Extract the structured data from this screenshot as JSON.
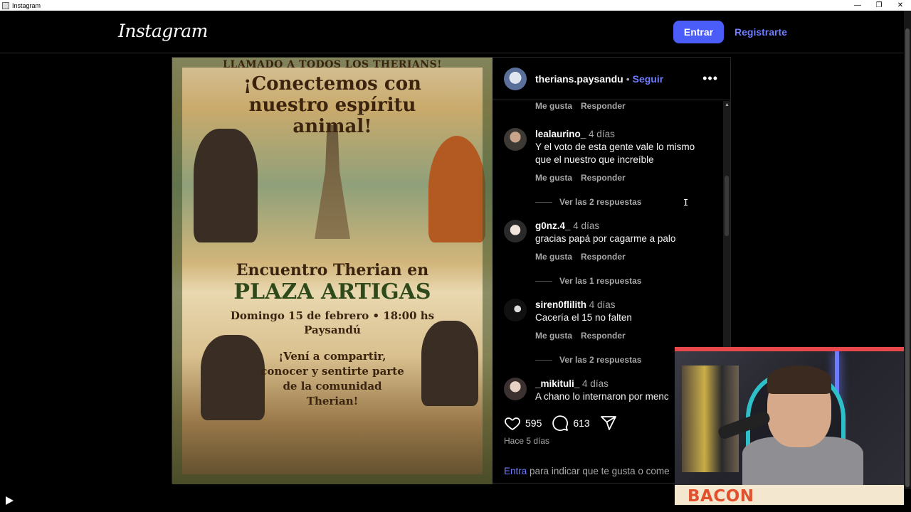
{
  "window": {
    "title": "Instagram",
    "controls": [
      "—",
      "❐",
      "✕"
    ]
  },
  "header": {
    "logo": "Instagram",
    "login_button": "Entrar",
    "signup_link": "Registrarte"
  },
  "poster": {
    "top_line": "LLAMADO A TODOS LOS THERIANS!",
    "headline": "¡Conectemos con nuestro espíritu animal!",
    "encuentro": "Encuentro Therian en",
    "plaza": "PLAZA ARTIGAS",
    "date": "Domingo 15 de febrero • 18:00 hs",
    "city": "Paysandú",
    "invite": "¡Vení a compartir, conocer y sentirte parte de la comunidad Therian!"
  },
  "post": {
    "owner": "therians.paysandu",
    "separator": "•",
    "follow": "Seguir",
    "more": "•••"
  },
  "comments": {
    "like_label": "Me gusta",
    "reply_label": "Responder",
    "items": [
      {
        "user": "lealaurino_",
        "time": "4 días",
        "text": "Y el voto de esta gente vale lo mismo que el nuestro que increíble",
        "replies": "Ver las 2 respuestas"
      },
      {
        "user": "g0nz.4_",
        "time": "4 días",
        "text": "gracias papá por cagarme a palo",
        "replies": "Ver las 1 respuestas"
      },
      {
        "user": "siren0flilith",
        "time": "4 días",
        "text": "Cacería el 15 no falten",
        "replies": "Ver las 2 respuestas"
      },
      {
        "user": "_mikituli_",
        "time": "4 días",
        "text": "A chano lo internaron por menc"
      }
    ]
  },
  "actions": {
    "likes": "595",
    "comments": "613"
  },
  "timeago": "Hace 5 días",
  "login_prompt": {
    "link": "Entra",
    "rest": "para indicar que te gusta o come"
  },
  "webcam": {
    "banner": "BACON"
  }
}
